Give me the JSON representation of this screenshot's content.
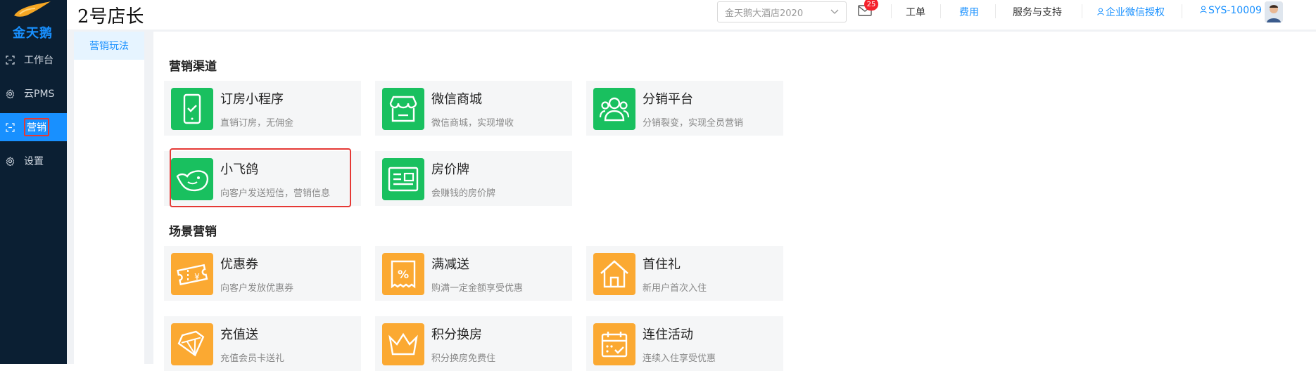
{
  "sidebar": {
    "logo_text": "金天鹅",
    "items": [
      {
        "label": "工作台",
        "icon": "workbench-icon"
      },
      {
        "label": "云PMS",
        "icon": "gear-icon"
      },
      {
        "label": "营销",
        "icon": "marketing-icon"
      },
      {
        "label": "设置",
        "icon": "gear-icon"
      }
    ]
  },
  "header": {
    "store_name": "2号店长",
    "hotel_select": "金天鹅大酒店2020",
    "mail_badge": "25",
    "links": [
      "工单",
      "费用",
      "服务与支持",
      "企业微信授权",
      "SYS-10009"
    ]
  },
  "submenu": {
    "active": "营销玩法"
  },
  "sections": [
    {
      "title": "营销渠道",
      "cards": [
        {
          "title": "订房小程序",
          "desc": "直销订房，无佣金",
          "icon": "phone-check-icon",
          "color": "green"
        },
        {
          "title": "微信商城",
          "desc": "微信商城，实现增收",
          "icon": "shop-icon",
          "color": "green"
        },
        {
          "title": "分销平台",
          "desc": "分销裂变，实现全员营销",
          "icon": "users-icon",
          "color": "green"
        },
        {
          "title": "小飞鸽",
          "desc": "向客户发送短信，营销信息",
          "icon": "bird-icon",
          "color": "green"
        },
        {
          "title": "房价牌",
          "desc": "会赚钱的房价牌",
          "icon": "price-card-icon",
          "color": "green"
        }
      ]
    },
    {
      "title": "场景营销",
      "cards": [
        {
          "title": "优惠券",
          "desc": "向客户发放优惠券",
          "icon": "coupon-icon",
          "color": "orange"
        },
        {
          "title": "满减送",
          "desc": "购满一定金额享受优惠",
          "icon": "percent-icon",
          "color": "orange"
        },
        {
          "title": "首住礼",
          "desc": "新用户首次入住",
          "icon": "house-icon",
          "color": "orange"
        },
        {
          "title": "充值送",
          "desc": "充值会员卡送礼",
          "icon": "diamond-icon",
          "color": "orange"
        },
        {
          "title": "积分换房",
          "desc": "积分换房免费住",
          "icon": "crown-icon",
          "color": "orange"
        },
        {
          "title": "连住活动",
          "desc": "连续入住享受优惠",
          "icon": "calendar-icon",
          "color": "orange"
        }
      ]
    }
  ],
  "colors": {
    "sidebar_bg": "#0b1f33",
    "accent": "#1890ff",
    "green": "#19c05f",
    "orange": "#fba932",
    "highlight": "#e53935"
  }
}
